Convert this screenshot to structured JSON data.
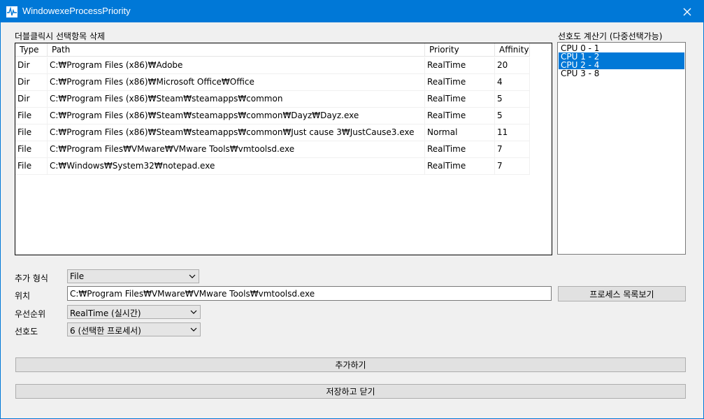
{
  "window": {
    "title": "WindowexeProcessPriority"
  },
  "labels": {
    "list_caption": "더블클릭시 선택항목 삭제",
    "cpu_caption": "선호도 계산기 (다중선택가능)",
    "add_type": "추가 형식",
    "location": "위치",
    "priority": "우선순위",
    "affinity": "선호도"
  },
  "table": {
    "headers": {
      "type": "Type",
      "path": "Path",
      "priority": "Priority",
      "affinity": "Affinity"
    },
    "rows": [
      {
        "type": "Dir",
        "path": "C:₩Program Files (x86)₩Adobe",
        "priority": "RealTime",
        "affinity": "20"
      },
      {
        "type": "Dir",
        "path": "C:₩Program Files (x86)₩Microsoft Office₩Office",
        "priority": "RealTime",
        "affinity": "4"
      },
      {
        "type": "Dir",
        "path": "C:₩Program Files (x86)₩Steam₩steamapps₩common",
        "priority": "RealTime",
        "affinity": "5"
      },
      {
        "type": "File",
        "path": "C:₩Program Files (x86)₩Steam₩steamapps₩common₩Dayz₩Dayz.exe",
        "priority": "RealTime",
        "affinity": "5"
      },
      {
        "type": "File",
        "path": "C:₩Program Files (x86)₩Steam₩steamapps₩common₩Just cause 3₩JustCause3.exe",
        "priority": "Normal",
        "affinity": "11"
      },
      {
        "type": "File",
        "path": "C:₩Program Files₩VMware₩VMware Tools₩vmtoolsd.exe",
        "priority": "RealTime",
        "affinity": "7"
      },
      {
        "type": "File",
        "path": "C:₩Windows₩System32₩notepad.exe",
        "priority": "RealTime",
        "affinity": "7"
      }
    ]
  },
  "cpu_list": {
    "items": [
      {
        "label": "CPU 0 - 1",
        "selected": false
      },
      {
        "label": "CPU 1 - 2",
        "selected": true
      },
      {
        "label": "CPU 2 - 4",
        "selected": true
      },
      {
        "label": "CPU 3 - 8",
        "selected": false
      }
    ]
  },
  "form": {
    "add_type_value": "File",
    "location_value": "C:₩Program Files₩VMware₩VMware Tools₩vmtoolsd.exe",
    "priority_value": "RealTime (실시간)",
    "affinity_value": "6 (선택한 프로세서)"
  },
  "buttons": {
    "process_list": "프로세스 목록보기",
    "add": "추가하기",
    "save_close": "저장하고 닫기"
  },
  "icons": {
    "app": "pulse-icon",
    "close": "close-icon",
    "dropdown": "chevron-down-icon"
  },
  "colors": {
    "titlebar": "#0078d7",
    "selection": "#0078d7"
  }
}
